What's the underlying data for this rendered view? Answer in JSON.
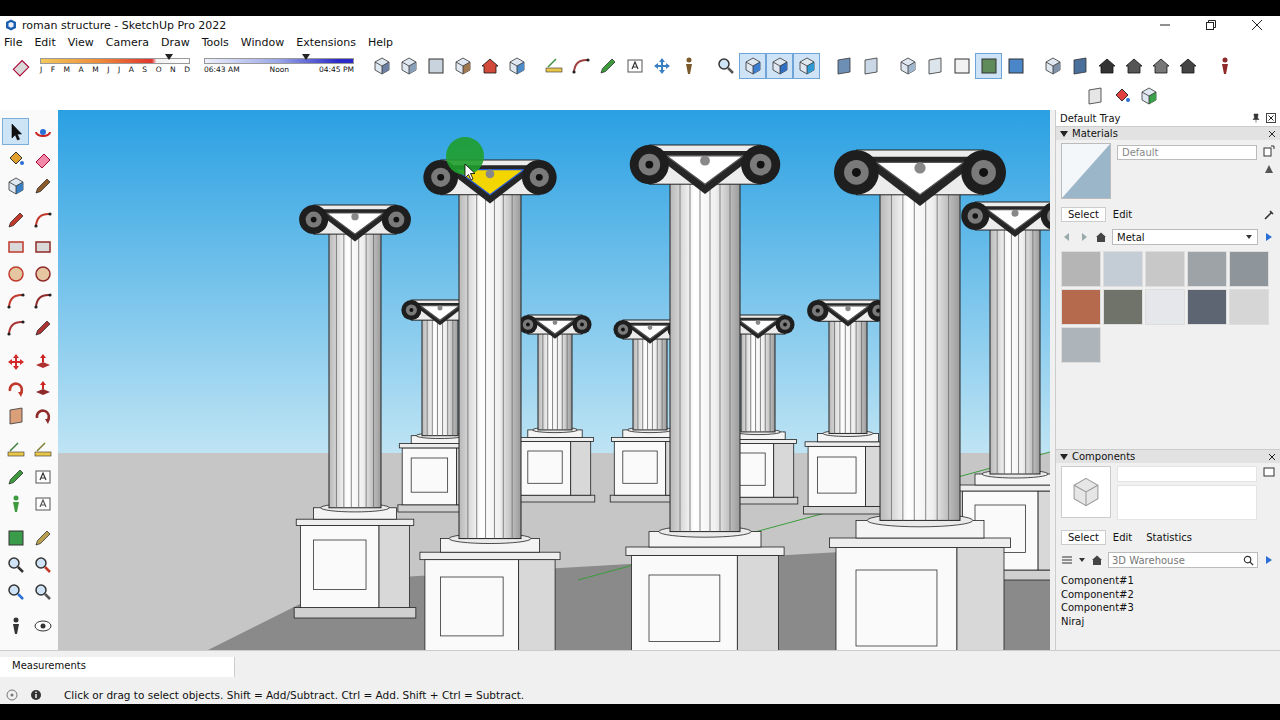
{
  "window": {
    "title": "roman structure - SketchUp Pro 2022"
  },
  "menu": [
    "File",
    "Edit",
    "View",
    "Camera",
    "Draw",
    "Tools",
    "Window",
    "Extensions",
    "Help"
  ],
  "shadow_settings": {
    "months": [
      "J",
      "F",
      "M",
      "A",
      "M",
      "J",
      "J",
      "A",
      "S",
      "O",
      "N",
      "D"
    ],
    "month_level": 0.86,
    "times": [
      "06:43 AM",
      "Noon",
      "04:45 PM"
    ],
    "time_level": 0.68
  },
  "toolbar": [
    {
      "selected": false
    },
    {
      "selected": false
    },
    {
      "selected": false
    },
    {
      "selected": false
    },
    {
      "selected": false
    },
    {
      "selected": false
    },
    {
      "selected": false
    },
    {
      "selected": false
    },
    {
      "selected": false
    },
    {
      "selected": false
    },
    {
      "selected": false
    },
    {
      "selected": false
    },
    {
      "selected": false
    },
    {
      "selected": true
    },
    {
      "selected": true
    },
    {
      "selected": true
    },
    {
      "selected": false
    },
    {
      "selected": false
    },
    {
      "selected": false
    },
    {
      "selected": false
    },
    {
      "selected": false
    },
    {
      "selected": true
    },
    {
      "selected": false
    },
    {
      "selected": false
    },
    {
      "selected": false
    },
    {
      "selected": false
    },
    {
      "selected": false
    },
    {
      "selected": false
    },
    {
      "selected": false
    },
    {
      "selected": false
    }
  ],
  "tool_palette": [
    {
      "selected": true
    },
    {
      "selected": false
    },
    {
      "selected": false
    },
    {
      "selected": false
    },
    {
      "selected": false
    },
    {
      "selected": false
    },
    {
      "selected": false
    },
    {
      "selected": false
    },
    {
      "selected": false
    },
    {
      "selected": false
    },
    {
      "selected": false
    },
    {
      "selected": false
    },
    {
      "selected": false
    },
    {
      "selected": false
    },
    {
      "selected": false
    },
    {
      "selected": false
    },
    {
      "selected": false
    },
    {
      "selected": false
    },
    {
      "selected": false
    },
    {
      "selected": false
    },
    {
      "selected": false
    },
    {
      "selected": false
    },
    {
      "selected": false
    },
    {
      "selected": false
    },
    {
      "selected": false
    },
    {
      "selected": false
    },
    {
      "selected": false
    },
    {
      "selected": false
    },
    {
      "selected": false
    },
    {
      "selected": false
    },
    {
      "selected": false
    },
    {
      "selected": false
    },
    {
      "selected": false
    },
    {
      "selected": false
    },
    {
      "selected": false
    },
    {
      "selected": false
    }
  ],
  "viewport": {
    "capital_selected": true
  },
  "tray": {
    "title": "Default Tray",
    "materials": {
      "header": "Materials",
      "expanded": true,
      "name": "Default",
      "tabs": [
        {
          "label": "Select",
          "selected": true
        },
        {
          "label": "Edit",
          "selected": false
        }
      ],
      "library": "Metal",
      "swatches": [
        {
          "color": "#b5b5b5"
        },
        {
          "color": "#c4cdd5"
        },
        {
          "color": "#c8c8c8"
        },
        {
          "color": "#9ea3a8"
        },
        {
          "color": "#8e959b"
        },
        {
          "color": "#b56a4e"
        },
        {
          "color": "#707369"
        },
        {
          "color": "#e5e7ea"
        },
        {
          "color": "#5e6572"
        },
        {
          "color": "#d6d6d6"
        },
        {
          "color": "#aeb5ba"
        }
      ]
    },
    "components": {
      "header": "Components",
      "expanded": true,
      "tabs": [
        {
          "label": "Select",
          "selected": true
        },
        {
          "label": "Edit",
          "selected": false
        },
        {
          "label": "Statistics",
          "selected": false
        }
      ],
      "search": {
        "placeholder": "3D Warehouse"
      },
      "items": [
        "Component#1",
        "Component#2",
        "Component#3",
        "Niraj"
      ]
    }
  },
  "measurements": {
    "label": "Measurements"
  },
  "status_bar": {
    "text": "Click or drag to select objects. Shift = Add/Subtract. Ctrl = Add. Shift + Ctrl = Subtract."
  }
}
